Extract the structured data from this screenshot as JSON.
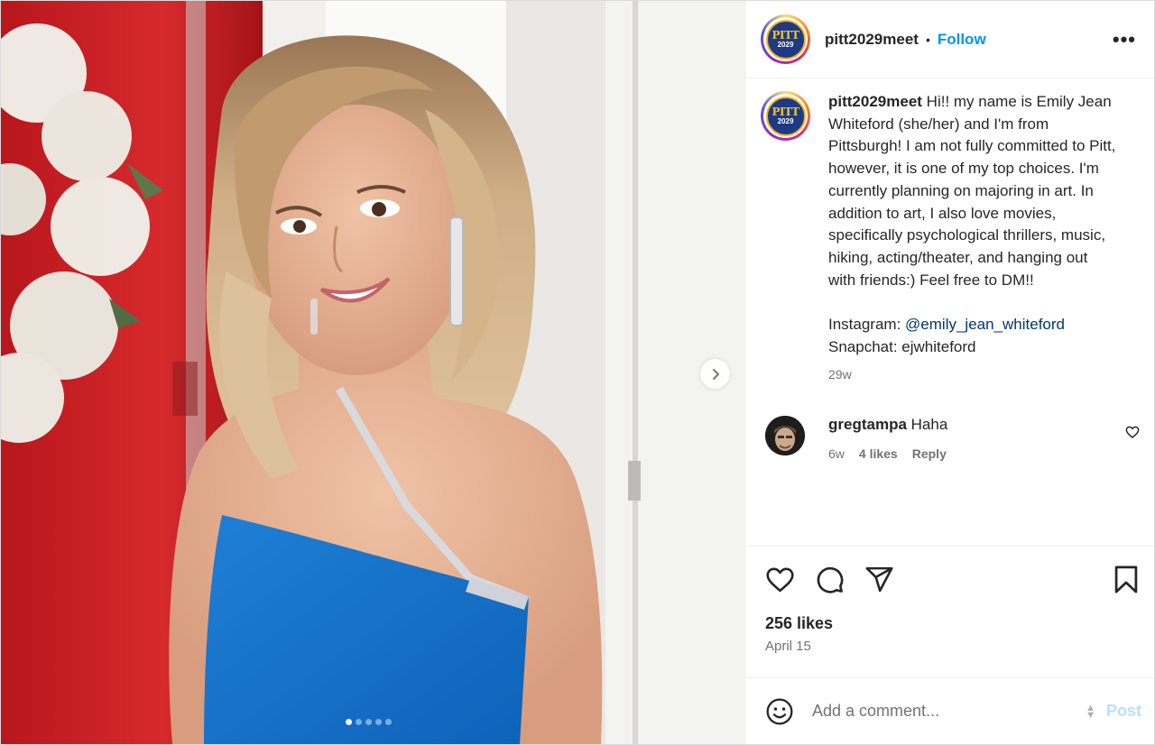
{
  "post": {
    "username": "pitt2029meet",
    "separator": "•",
    "follow_label": "Follow",
    "more_label": "•••",
    "avatar_logo": {
      "line1": "PITT",
      "line2": "2029",
      "ring_colors": [
        "#feda75",
        "#fa7e1e",
        "#d62976",
        "#962fbf",
        "#4f5bd5"
      ],
      "badge_color": "#1c3a86",
      "accent": "#f6c12e"
    },
    "image_icon": "photo-woman-blue-dress",
    "carousel": {
      "next_icon": "chevron-right-icon",
      "dot_count": 5,
      "active_index": 0
    }
  },
  "caption": {
    "username": "pitt2029meet",
    "text": " Hi!! my name is Emily Jean Whiteford (she/her) and I'm from Pittsburgh! I am not fully committed to Pitt, however, it is one of my top choices. I'm currently planning on majoring in art. In addition to art, I also love movies, specifically psychological thrillers, music, hiking, acting/theater, and hanging out with friends:) Feel free to DM!!",
    "instagram_label": "Instagram: ",
    "instagram_handle": "@emily_jean_whiteford",
    "snapchat_line": "Snapchat: ejwhiteford",
    "time": "29w"
  },
  "comments": [
    {
      "username": "gregtampa",
      "text": " Haha",
      "time": "6w",
      "likes": "4 likes",
      "reply": "Reply"
    }
  ],
  "actions": {
    "likes": "256 likes",
    "date": "April 15"
  },
  "add_comment": {
    "placeholder": "Add a comment...",
    "post_label": "Post",
    "post_color": "#b9dffc"
  },
  "colors": {
    "link": "#0095f6",
    "mention": "#00376b",
    "muted": "#737373",
    "text": "#262626"
  }
}
